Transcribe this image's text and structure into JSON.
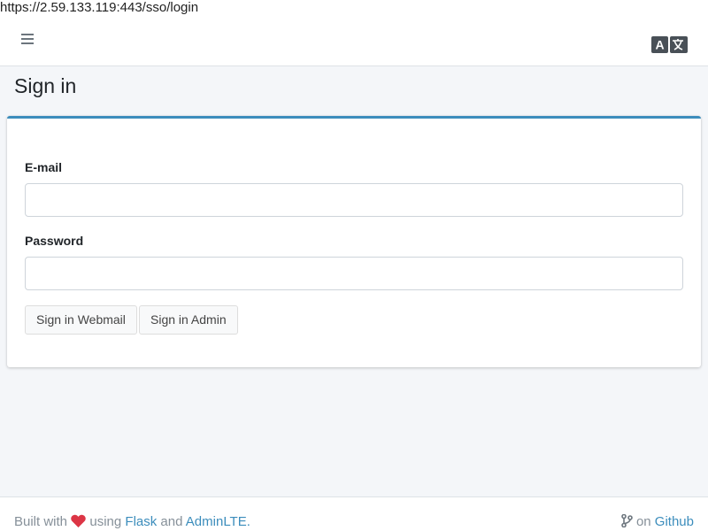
{
  "browser": {
    "url": "https://2.59.133.119:443/sso/login"
  },
  "header": {
    "menu_icon": "bars-icon",
    "language_icon": "language-icon"
  },
  "page": {
    "title": "Sign in"
  },
  "form": {
    "email_label": "E-mail",
    "email_value": "",
    "password_label": "Password",
    "password_value": "",
    "buttons": [
      "Sign in Webmail",
      "Sign in Admin"
    ]
  },
  "footer": {
    "built_with": "Built with",
    "heart_icon": "heart-icon",
    "using": "using",
    "flask_link": "Flask",
    "and": "and",
    "adminlte_link": "AdminLTE.",
    "branch_icon": "code-branch-icon",
    "on": "on",
    "github_link": "Github"
  },
  "colors": {
    "accent": "#3c8dbc",
    "heart": "#dc3545",
    "footer_text": "#869099",
    "background": "#f4f6f9"
  }
}
